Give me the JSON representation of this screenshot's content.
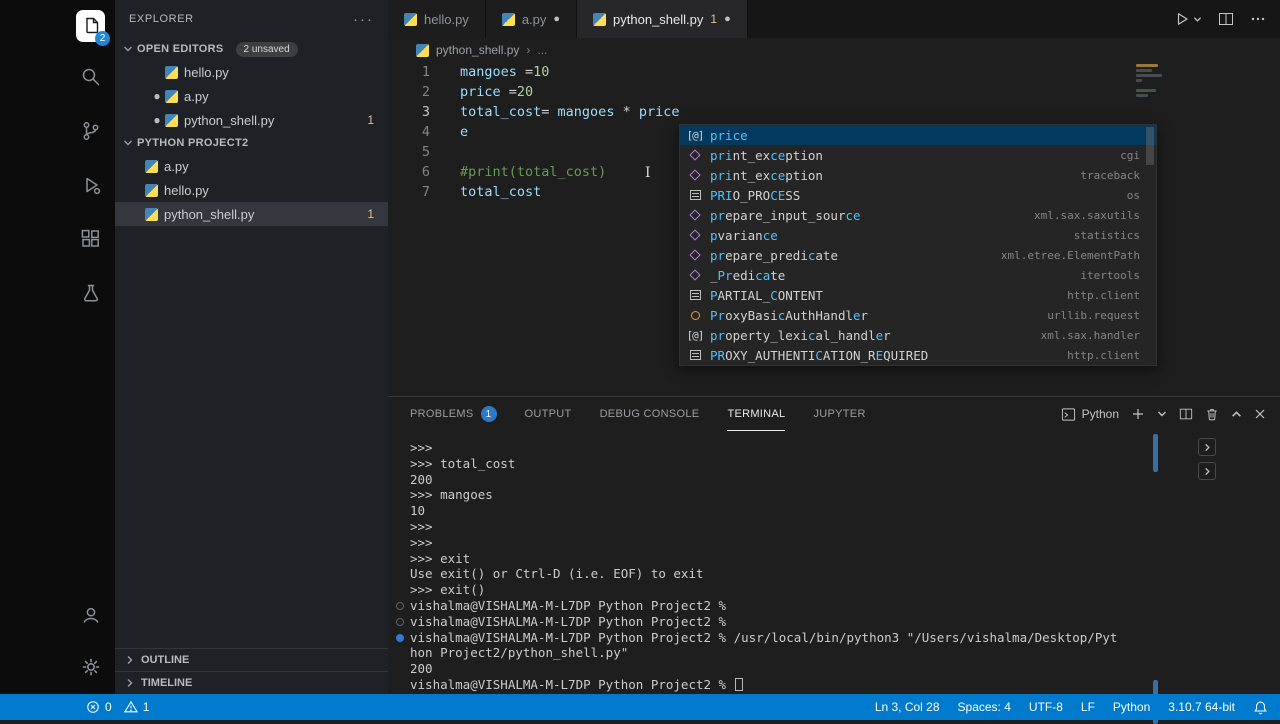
{
  "activity_bar": {
    "explorer_badge": "2"
  },
  "sidebar": {
    "title": "EXPLORER",
    "more": "···",
    "open_editors": {
      "label": "OPEN EDITORS",
      "badge": "2 unsaved",
      "items": [
        {
          "label": "hello.py",
          "modified": false,
          "badge": ""
        },
        {
          "label": "a.py",
          "modified": true,
          "badge": ""
        },
        {
          "label": "python_shell.py",
          "modified": true,
          "badge": "1"
        }
      ]
    },
    "project": {
      "label": "PYTHON PROJECT2",
      "items": [
        {
          "label": "a.py",
          "selected": false,
          "badge": ""
        },
        {
          "label": "hello.py",
          "selected": false,
          "badge": ""
        },
        {
          "label": "python_shell.py",
          "selected": true,
          "badge": "1"
        }
      ]
    },
    "outline_label": "OUTLINE",
    "timeline_label": "TIMELINE"
  },
  "editor": {
    "tabs": [
      {
        "label": "hello.py",
        "modified": false,
        "active": false,
        "badge": ""
      },
      {
        "label": "a.py",
        "modified": true,
        "active": false,
        "badge": ""
      },
      {
        "label": "python_shell.py",
        "modified": true,
        "active": true,
        "badge": "1"
      }
    ],
    "breadcrumb": {
      "file": "python_shell.py",
      "separator": "›",
      "more": "..."
    },
    "lines": [
      {
        "num": "1",
        "active": false,
        "tokens": [
          {
            "t": "mangoes ",
            "c": "v"
          },
          {
            "t": "=",
            "c": "o"
          },
          {
            "t": "10",
            "c": "n"
          }
        ]
      },
      {
        "num": "2",
        "active": false,
        "tokens": [
          {
            "t": "price ",
            "c": "v"
          },
          {
            "t": "=",
            "c": "o"
          },
          {
            "t": "20",
            "c": "n"
          }
        ]
      },
      {
        "num": "3",
        "active": true,
        "tokens": [
          {
            "t": "total_cost",
            "c": "v"
          },
          {
            "t": "= ",
            "c": "o"
          },
          {
            "t": "mangoes",
            "c": "v"
          },
          {
            "t": " * ",
            "c": "o"
          },
          {
            "t": "price",
            "c": "v"
          }
        ]
      },
      {
        "num": "4",
        "active": false,
        "tokens": [
          {
            "t": "e",
            "c": "v"
          }
        ]
      },
      {
        "num": "5",
        "active": false,
        "tokens": []
      },
      {
        "num": "6",
        "active": false,
        "tokens": [
          {
            "t": "#print(total_cost)",
            "c": "c"
          }
        ]
      },
      {
        "num": "7",
        "active": false,
        "tokens": [
          {
            "t": "total_cost",
            "c": "v"
          }
        ]
      }
    ]
  },
  "suggest": {
    "items": [
      {
        "kind": "property",
        "selected": true,
        "detail": "",
        "parts": [
          {
            "t": "price",
            "h": true
          }
        ]
      },
      {
        "kind": "method",
        "selected": false,
        "detail": "cgi",
        "parts": [
          {
            "t": "pri",
            "h": true
          },
          {
            "t": "nt_ex"
          },
          {
            "t": "ce",
            "h": true
          },
          {
            "t": "ption"
          }
        ]
      },
      {
        "kind": "method",
        "selected": false,
        "detail": "traceback",
        "parts": [
          {
            "t": "pri",
            "h": true
          },
          {
            "t": "nt_ex"
          },
          {
            "t": "ce",
            "h": true
          },
          {
            "t": "ption"
          }
        ]
      },
      {
        "kind": "constant",
        "selected": false,
        "detail": "os",
        "parts": [
          {
            "t": "PRI",
            "h": true
          },
          {
            "t": "O_PRO"
          },
          {
            "t": "CE",
            "h": true
          },
          {
            "t": "SS"
          }
        ]
      },
      {
        "kind": "method",
        "selected": false,
        "detail": "xml.sax.saxutils",
        "parts": [
          {
            "t": "pr",
            "h": true
          },
          {
            "t": "epare_input_sour"
          },
          {
            "t": "ce",
            "h": true
          }
        ]
      },
      {
        "kind": "method",
        "selected": false,
        "detail": "statistics",
        "parts": [
          {
            "t": "p",
            "h": true
          },
          {
            "t": "varian"
          },
          {
            "t": "ce",
            "h": true
          }
        ]
      },
      {
        "kind": "method",
        "selected": false,
        "detail": "xml.etree.ElementPath",
        "parts": [
          {
            "t": "pr",
            "h": true
          },
          {
            "t": "epare_predi"
          },
          {
            "t": "c",
            "h": true
          },
          {
            "t": "ate"
          }
        ]
      },
      {
        "kind": "method",
        "selected": false,
        "detail": "itertools",
        "parts": [
          {
            "t": "_"
          },
          {
            "t": "Pr",
            "h": true
          },
          {
            "t": "edi"
          },
          {
            "t": "ca",
            "h": true
          },
          {
            "t": "te"
          }
        ]
      },
      {
        "kind": "constant",
        "selected": false,
        "detail": "http.client",
        "parts": [
          {
            "t": "P",
            "h": true
          },
          {
            "t": "ARTIAL_"
          },
          {
            "t": "C",
            "h": true
          },
          {
            "t": "ONTENT"
          }
        ]
      },
      {
        "kind": "class",
        "selected": false,
        "detail": "urllib.request",
        "parts": [
          {
            "t": "Pr",
            "h": true
          },
          {
            "t": "oxyBasi"
          },
          {
            "t": "c",
            "h": true
          },
          {
            "t": "AuthHandl"
          },
          {
            "t": "e",
            "h": true
          },
          {
            "t": "r"
          }
        ]
      },
      {
        "kind": "property",
        "selected": false,
        "detail": "xml.sax.handler",
        "parts": [
          {
            "t": "pr",
            "h": true
          },
          {
            "t": "operty_lexi"
          },
          {
            "t": "c",
            "h": true
          },
          {
            "t": "al_handl"
          },
          {
            "t": "e",
            "h": true
          },
          {
            "t": "r"
          }
        ]
      },
      {
        "kind": "constant",
        "selected": false,
        "detail": "http.client",
        "parts": [
          {
            "t": "PR",
            "h": true
          },
          {
            "t": "OXY_AUTHENTI"
          },
          {
            "t": "C",
            "h": true
          },
          {
            "t": "ATION_R"
          },
          {
            "t": "E",
            "h": true
          },
          {
            "t": "QUIRED"
          }
        ]
      }
    ]
  },
  "panel": {
    "tabs": [
      {
        "label": "PROBLEMS",
        "badge": "1",
        "active": false
      },
      {
        "label": "OUTPUT",
        "badge": "",
        "active": false
      },
      {
        "label": "DEBUG CONSOLE",
        "badge": "",
        "active": false
      },
      {
        "label": "TERMINAL",
        "badge": "",
        "active": true
      },
      {
        "label": "JUPYTER",
        "badge": "",
        "active": false
      }
    ],
    "profile_label": "Python"
  },
  "terminal": {
    "lines": [
      {
        "text": ">>>",
        "deco": "none",
        "cursor": false
      },
      {
        "text": ">>> total_cost",
        "deco": "none",
        "cursor": false
      },
      {
        "text": "200",
        "deco": "none",
        "cursor": false
      },
      {
        "text": ">>> mangoes",
        "deco": "none",
        "cursor": false
      },
      {
        "text": "10",
        "deco": "none",
        "cursor": false
      },
      {
        "text": ">>>",
        "deco": "none",
        "cursor": false
      },
      {
        "text": ">>>",
        "deco": "none",
        "cursor": false
      },
      {
        "text": ">>> exit",
        "deco": "none",
        "cursor": false
      },
      {
        "text": "Use exit() or Ctrl-D (i.e. EOF) to exit",
        "deco": "none",
        "cursor": false
      },
      {
        "text": ">>> exit()",
        "deco": "none",
        "cursor": false
      },
      {
        "text": "vishalma@VISHALMA-M-L7DP Python Project2 %",
        "deco": "circle",
        "cursor": false
      },
      {
        "text": "vishalma@VISHALMA-M-L7DP Python Project2 %",
        "deco": "circle",
        "cursor": false
      },
      {
        "text": "vishalma@VISHALMA-M-L7DP Python Project2 % /usr/local/bin/python3 \"/Users/vishalma/Desktop/Pyt",
        "deco": "filled",
        "cursor": false
      },
      {
        "text": "hon Project2/python_shell.py\"",
        "deco": "none",
        "cursor": false
      },
      {
        "text": "200",
        "deco": "none",
        "cursor": false
      },
      {
        "text": "vishalma@VISHALMA-M-L7DP Python Project2 % ",
        "deco": "none",
        "cursor": true
      }
    ]
  },
  "status_bar": {
    "errors": "0",
    "warnings": "1",
    "items": [
      {
        "name": "cursor-position",
        "label": "Ln 3, Col 28"
      },
      {
        "name": "indentation",
        "label": "Spaces: 4"
      },
      {
        "name": "encoding",
        "label": "UTF-8"
      },
      {
        "name": "eol",
        "label": "LF"
      },
      {
        "name": "language-mode",
        "label": "Python"
      },
      {
        "name": "python-version",
        "label": "3.10.7 64-bit"
      }
    ]
  },
  "colors": {
    "accent": "#007acc",
    "suggest_selection": "#04395e"
  }
}
